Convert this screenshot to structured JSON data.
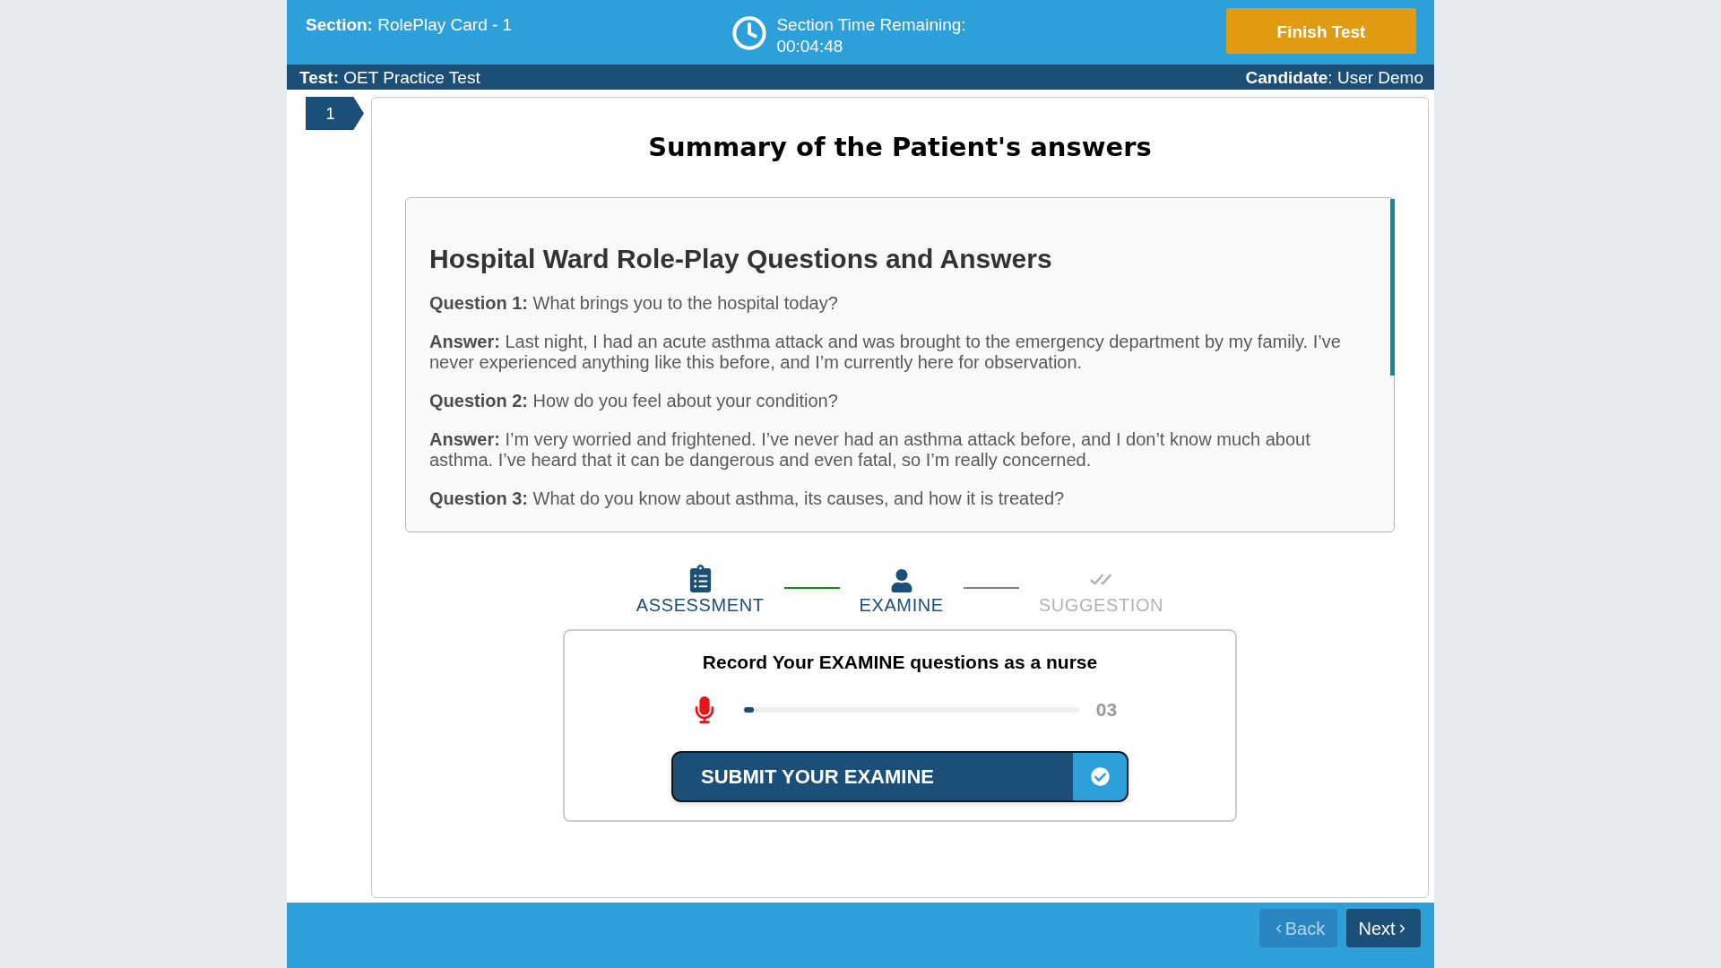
{
  "header": {
    "section": "**Section:** RolePlay Card - 1",
    "timer_label": "Section Time Remaining:",
    "timer_value": "00:04:48",
    "finish_button": "Finish Test"
  },
  "info_bar": {
    "test": "**Test:** OET Practice Test",
    "candidate": "**Candidate**: User Demo"
  },
  "question_tabs": [
    {
      "label": "1"
    }
  ],
  "card": {
    "title": "Summary of the Patient's answers",
    "transcript": {
      "heading": "Hospital Ward Role-Play Questions and Answers",
      "entries": [
        "**Question 1:** What brings you to the hospital today?",
        "**Answer:** Last night, I had an acute asthma attack and was brought to the emergency department by my family. I’ve never experienced anything like this before, and I’m currently here for observation.",
        "**Question 2:** How do you feel about your condition?",
        "**Answer:** I’m very worried and frightened. I’ve never had an asthma attack before, and I don’t know much about asthma. I’ve heard that it can be dangerous and even fatal, so I’m really concerned.",
        "**Question 3:** What do you know about asthma, its causes, and how it is treated?"
      ]
    }
  },
  "steps": [
    {
      "label": "ASSESSMENT",
      "reached": true
    },
    {
      "label": "EXAMINE",
      "reached": true
    },
    {
      "label": "SUGGESTION",
      "reached": false
    }
  ],
  "recorder": {
    "title": "Record Your EXAMINE questions as a nurse",
    "level": 0.03,
    "reading": "03",
    "submit_button": "SUBMIT YOUR EXAMINE"
  },
  "footer": {
    "buttons": [
      {
        "label": "Back",
        "kind": "back",
        "disabled": true
      },
      {
        "label": "Next",
        "kind": "next",
        "disabled": false
      }
    ]
  }
}
